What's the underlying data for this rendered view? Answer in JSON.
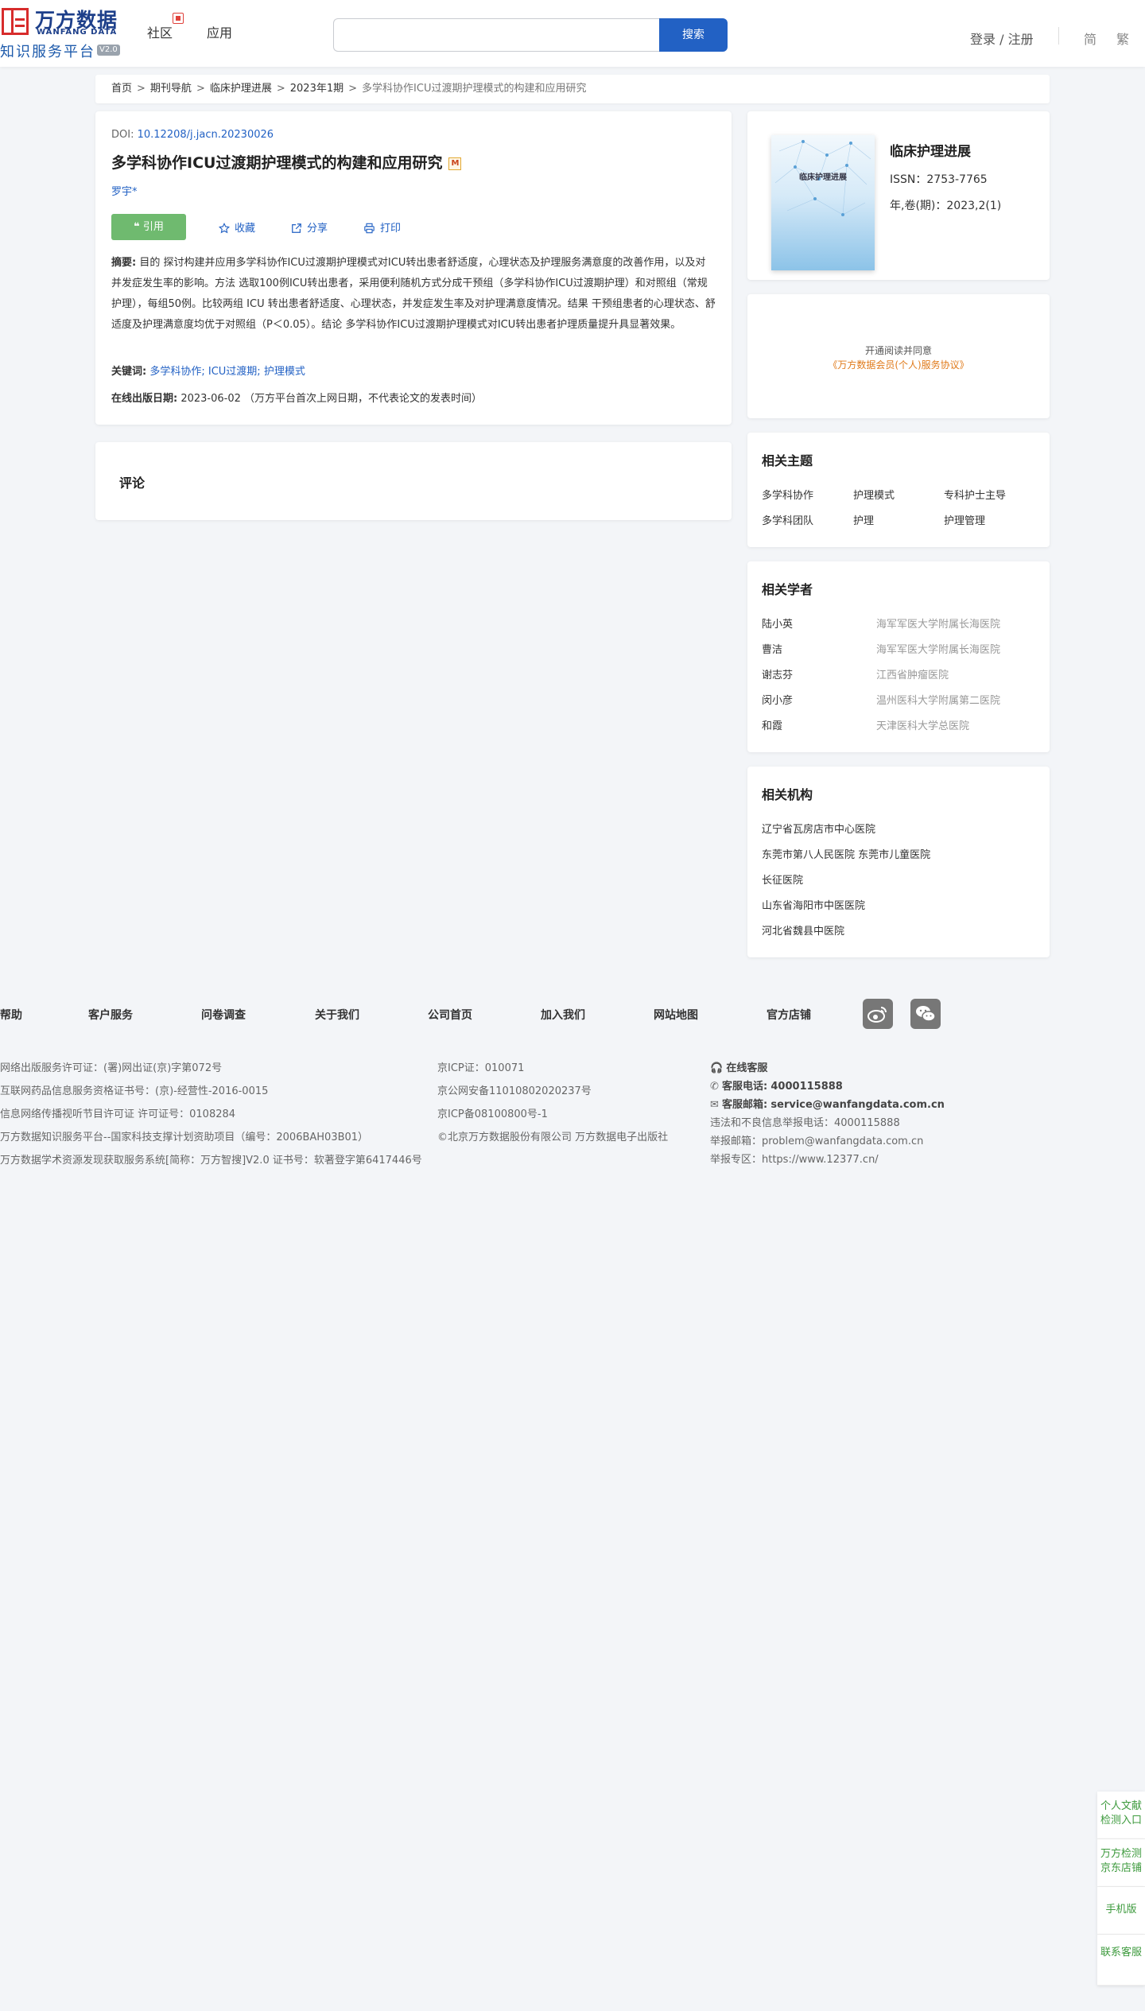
{
  "header": {
    "logo_cn": "万方数据",
    "logo_en": "WANFANG DATA",
    "logo_sub": "知识服务平台",
    "logo_version": "V2.0",
    "nav": [
      "社区",
      "应用"
    ],
    "search_button": "搜索",
    "search_placeholder": "",
    "login": "登录 / 注册",
    "lang_simplified": "简",
    "lang_traditional": "繁"
  },
  "breadcrumb": [
    "首页",
    "期刊导航",
    "临床护理进展",
    "2023年1期",
    "多学科协作ICU过渡期护理模式的构建和应用研究"
  ],
  "article": {
    "doi_label": "DOI:",
    "doi": "10.12208/j.jacn.20230026",
    "title": "多学科协作ICU过渡期护理模式的构建和应用研究",
    "title_badge": "M",
    "author": "罗宇*",
    "actions": {
      "cite": "引用",
      "favorite": "收藏",
      "share": "分享",
      "print": "打印"
    },
    "abstract_label": "摘要:",
    "abstract": "目的 探讨构建并应用多学科协作ICU过渡期护理模式对ICU转出患者舒适度，心理状态及护理服务满意度的改善作用，以及对并发症发生率的影响。方法 选取100例ICU转出患者，采用便利随机方式分成干预组（多学科协作ICU过渡期护理）和对照组（常规护理），每组50例。比较两组 ICU 转出患者舒适度、心理状态，并发症发生率及对护理满意度情况。结果 干预组患者的心理状态、舒适度及护理满意度均优于对照组（P＜0.05）。结论 多学科协作ICU过渡期护理模式对ICU转出患者护理质量提升具显著效果。",
    "keywords_label": "关键词:",
    "keywords": [
      "多学科协作;",
      "ICU过渡期;",
      "护理模式"
    ],
    "pubdate_label": "在线出版日期:",
    "pubdate": "2023-06-02",
    "pubdate_note": "（万方平台首次上网日期，不代表论文的发表时间）"
  },
  "comment": {
    "title": "评论"
  },
  "journal": {
    "cover_title": "临床护理进展",
    "name": "临床护理进展",
    "issn": "ISSN：2753-7765",
    "volume": "年,卷(期)：2023,2(1)"
  },
  "open_read": {
    "text": "开通阅读并同意",
    "link": "《万方数据会员(个人)服务协议》"
  },
  "topics": {
    "title": "相关主题",
    "items": [
      "多学科协作",
      "护理模式",
      "专科护士主导",
      "多学科团队",
      "护理",
      "护理管理"
    ]
  },
  "scholars": {
    "title": "相关学者",
    "items": [
      {
        "name": "陆小英",
        "org": "海军军医大学附属长海医院"
      },
      {
        "name": "曹洁",
        "org": "海军军医大学附属长海医院"
      },
      {
        "name": "谢志芬",
        "org": "江西省肿瘤医院"
      },
      {
        "name": "闵小彦",
        "org": "温州医科大学附属第二医院"
      },
      {
        "name": "和霞",
        "org": "天津医科大学总医院"
      }
    ]
  },
  "orgs": {
    "title": "相关机构",
    "items": [
      "辽宁省瓦房店市中心医院",
      "东莞市第八人民医院 东莞市儿童医院",
      "长征医院",
      "山东省海阳市中医医院",
      "河北省魏县中医院"
    ]
  },
  "footer": {
    "nav": [
      "帮助",
      "客户服务",
      "问卷调查",
      "关于我们",
      "公司首页",
      "加入我们",
      "网站地图",
      "官方店铺"
    ],
    "col1": [
      "网络出版服务许可证：(署)网出证(京)字第072号",
      "互联网药品信息服务资格证书号：(京)-经营性-2016-0015",
      "信息网络传播视听节目许可证 许可证号：0108284",
      "万方数据知识服务平台--国家科技支撑计划资助项目（编号：2006BAH03B01）",
      "万方数据学术资源发现获取服务系统[简称：万方智搜]V2.0 证书号：软著登字第6417446号"
    ],
    "col2": [
      "京ICP证：010071",
      "京公网安备11010802020237号",
      "京ICP备08100800号-1",
      "©北京万方数据股份有限公司 万方数据电子出版社"
    ],
    "online_service": "在线客服",
    "phone_label": "客服电话:",
    "phone": "4000115888",
    "email_label": "客服邮箱:",
    "email": "service@wanfangdata.com.cn",
    "report_phone": "违法和不良信息举报电话：4000115888",
    "report_email": "举报邮箱：problem@wanfangdata.com.cn",
    "report_zone": "举报专区：https://www.12377.cn/"
  },
  "side": [
    "个人文献检测入口",
    "万方检测京东店铺",
    "手机版",
    "联系客服"
  ],
  "colors": {
    "primary": "#2261c4",
    "cite_green": "#6fba6f",
    "link_orange": "#e07a1a",
    "side_green": "#3d9a3d"
  }
}
